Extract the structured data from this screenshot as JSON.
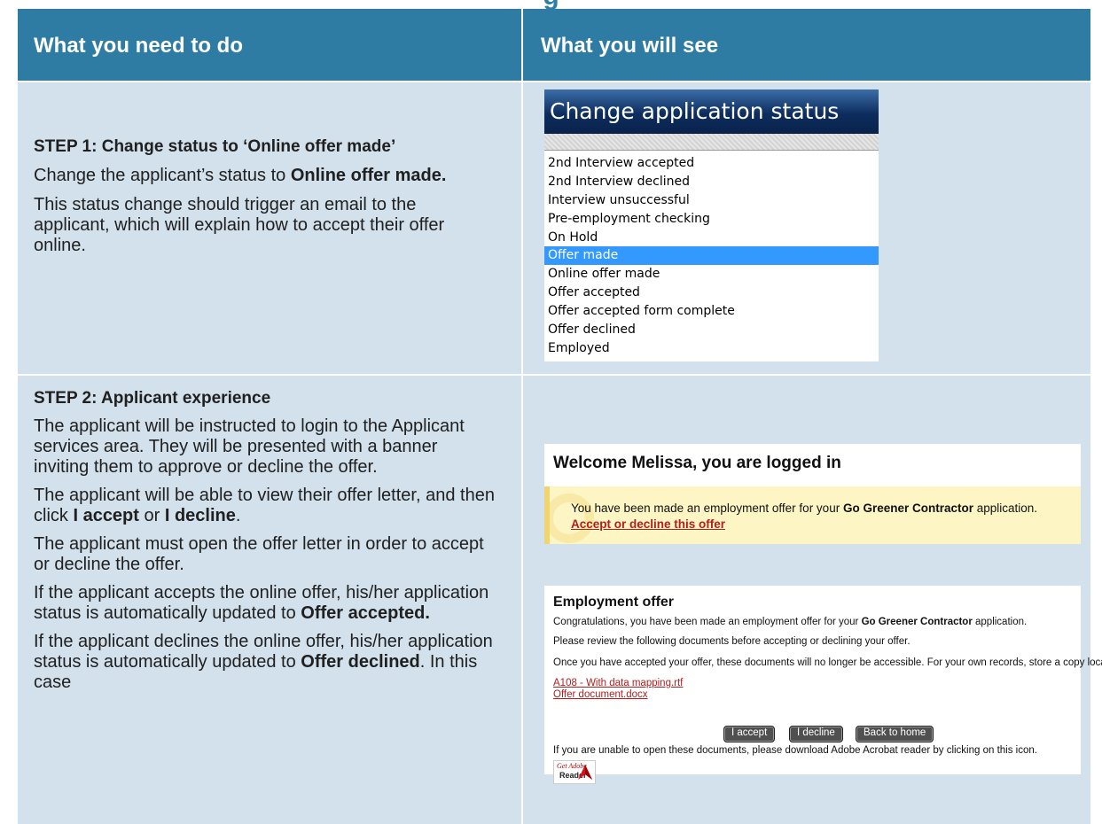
{
  "page": {
    "clipped_title": "g"
  },
  "table": {
    "headers": {
      "left": "What you need to do",
      "right": "What you will see"
    },
    "step1": {
      "title": "STEP 1: Change status to ‘Online offer made’",
      "p1_prefix": "Change the applicant’s status to ",
      "p1_bold": "Online offer made.",
      "p2": "This status change should trigger an email to the applicant, which will explain how to accept their offer online."
    },
    "step2": {
      "title": "STEP 2: Applicant experience",
      "p1": "The applicant will be instructed to login to the Applicant services area.  They will be presented with a banner inviting them to approve or decline the offer.",
      "p2_prefix": "The applicant will be able to view their offer letter, and then click ",
      "p2_bold1": "I accept",
      "p2_mid": " or ",
      "p2_bold2": "I decline",
      "p2_suffix": ".",
      "p3": "The applicant must open the offer letter in order to accept or decline the offer.",
      "p4_prefix": "If the applicant accepts the online offer, his/her application status is automatically updated to ",
      "p4_bold": "Offer accepted.",
      "p5_prefix": "If the applicant declines the online offer, his/her application status is automatically updated to ",
      "p5_bold": "Offer declined",
      "p5_suffix": ".  In this case"
    }
  },
  "status_screenshot": {
    "banner": "Change application status",
    "options": [
      "2nd Interview accepted",
      "2nd Interview declined",
      "Interview unsuccessful",
      "Pre-employment checking",
      "On Hold",
      "Offer made",
      "Online offer made",
      "Offer accepted",
      "Offer accepted form complete",
      "Offer declined",
      "Employed"
    ],
    "selected": "Offer made"
  },
  "welcome_screenshot": {
    "heading": "Welcome Melissa, you are logged in",
    "notice_prefix": "You have been made an employment offer for your ",
    "notice_bold": "Go Greener Contractor",
    "notice_suffix": " application.",
    "link": "Accept or decline this offer"
  },
  "offer_screenshot": {
    "heading": "Employment offer",
    "line1_prefix": "Congratulations, you have been made an employment offer for your ",
    "line1_bold": "Go Greener Contractor",
    "line1_suffix": " application.",
    "line2": "Please review the following documents before accepting or declining your offer.",
    "line3": "Once you have accepted your offer, these documents will no longer be accessible. For your own records, store a copy locally.",
    "doc1": "A108 - With data mapping.rtf",
    "doc2": "Offer document.docx",
    "buttons": {
      "accept": "I accept",
      "decline": "I decline",
      "home": "Back to home"
    },
    "reader_note": "If you are unable to open these documents, please download Adobe Acrobat reader by clicking on this icon.",
    "badge": {
      "get": "Get Adobe",
      "reader": "Reader"
    }
  }
}
